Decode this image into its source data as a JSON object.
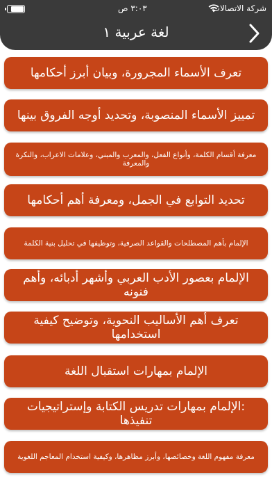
{
  "status_bar": {
    "carrier": "شركة الاتصالات",
    "time": "٣:٠٣ ص",
    "battery_level": 0.85
  },
  "header": {
    "title": "لغة عربية ١",
    "back_icon": "chevron-right-icon",
    "background": "#3a3a3a"
  },
  "accent_color": "#c64518",
  "items": [
    {
      "label": "تعرف الأسماء المجرورة، وبيان أبرز أحكامها"
    },
    {
      "label": "تمييز الأسماء المنصوبة، وتحديد أوجه الفروق بينها"
    },
    {
      "label": "معرفة أقسام الكلمة، وأنواع الفعل، والمعرب والمبني، وعلامات الاعراب، والنكرة والمعرفة"
    },
    {
      "label": "تحديد التوابع في الجمل، ومعرفة أهم أحكامها"
    },
    {
      "label": "الإلمام بأهم المصطلحات والقواعد الصرفية، وتوظيفها في تحليل بنية الكلمة"
    },
    {
      "label": "الإلمام بعصور الأدب العربي وأشهر أدبائه، وأهم فنونه"
    },
    {
      "label": "تعرف أهم الأساليب النحوية، وتوضيح كيفية استخدامها"
    },
    {
      "label": "الإلمام بمهارات استقبال اللغة"
    },
    {
      "label": ":الإلمام بمهارات تدريس الكتابة وإستراتيجيات تنفيذها"
    },
    {
      "label": "معرفة مفهوم اللغة وخصائصها، وأبرز مظاهرها، وكيفية استخدام المعاجم اللغوية"
    }
  ]
}
